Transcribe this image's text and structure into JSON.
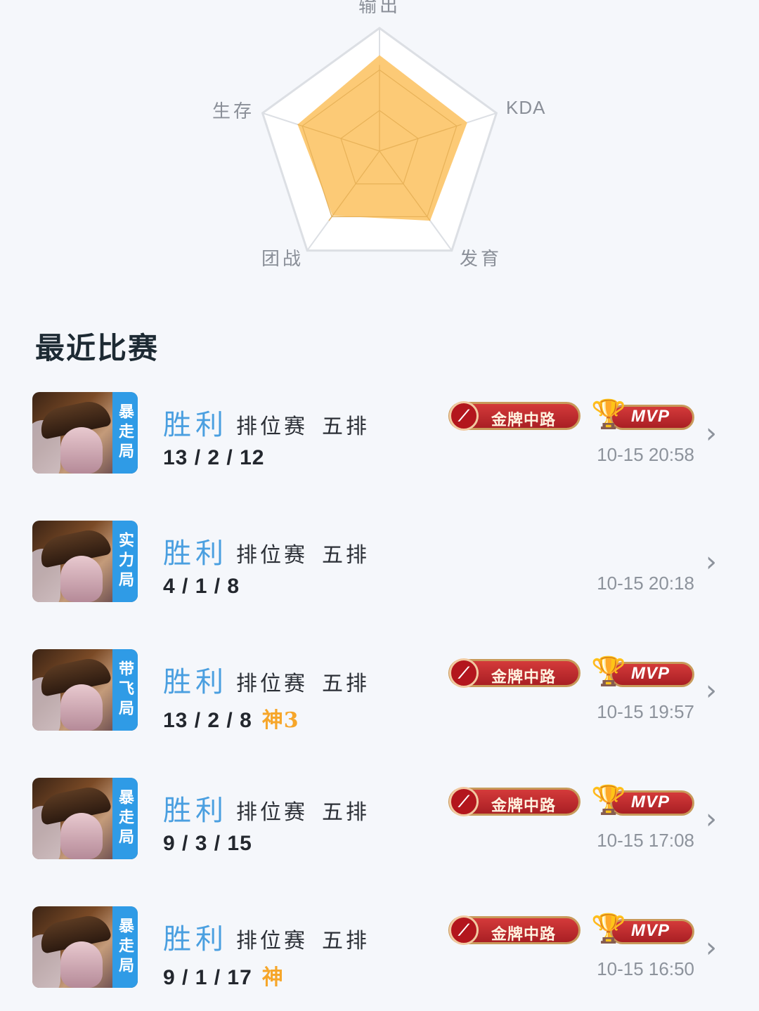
{
  "radar": {
    "labels": {
      "top": "输出",
      "right": "KDA",
      "bottom_right": "发育",
      "bottom_left": "团战",
      "left": "生存"
    },
    "values": {
      "top": 0.78,
      "right": 0.75,
      "bottom_right": 0.7,
      "bottom_left": 0.65,
      "left": 0.7
    },
    "fill_color": "#fcc66a"
  },
  "section": {
    "title": "最近比赛"
  },
  "matches": [
    {
      "tag": "暴走局",
      "result": "胜利",
      "mode": "排位赛",
      "queue": "五排",
      "kda": "13 / 2 / 12",
      "extra": "",
      "badge_gold": "金牌中路",
      "badge_mvp": "MVP",
      "time": "10-15  20:58",
      "has_badges": true
    },
    {
      "tag": "实力局",
      "result": "胜利",
      "mode": "排位赛",
      "queue": "五排",
      "kda": "4 / 1 / 8",
      "extra": "",
      "badge_gold": "",
      "badge_mvp": "",
      "time": "10-15  20:18",
      "has_badges": false
    },
    {
      "tag": "带飞局",
      "result": "胜利",
      "mode": "排位赛",
      "queue": "五排",
      "kda": "13 / 2 / 8",
      "extra": "神3",
      "badge_gold": "金牌中路",
      "badge_mvp": "MVP",
      "time": "10-15  19:57",
      "has_badges": true
    },
    {
      "tag": "暴走局",
      "result": "胜利",
      "mode": "排位赛",
      "queue": "五排",
      "kda": "9 / 3 / 15",
      "extra": "",
      "badge_gold": "金牌中路",
      "badge_mvp": "MVP",
      "time": "10-15  17:08",
      "has_badges": true
    },
    {
      "tag": "暴走局",
      "result": "胜利",
      "mode": "排位赛",
      "queue": "五排",
      "kda": "9 / 1 / 17",
      "extra": "神",
      "badge_gold": "金牌中路",
      "badge_mvp": "MVP",
      "time": "10-15  16:50",
      "has_badges": true
    }
  ],
  "colors": {
    "result": "#4a9fe0",
    "tag_bg": "#2f9be6",
    "badge_red": "#c0282d",
    "godlike": "#f6a62a"
  }
}
